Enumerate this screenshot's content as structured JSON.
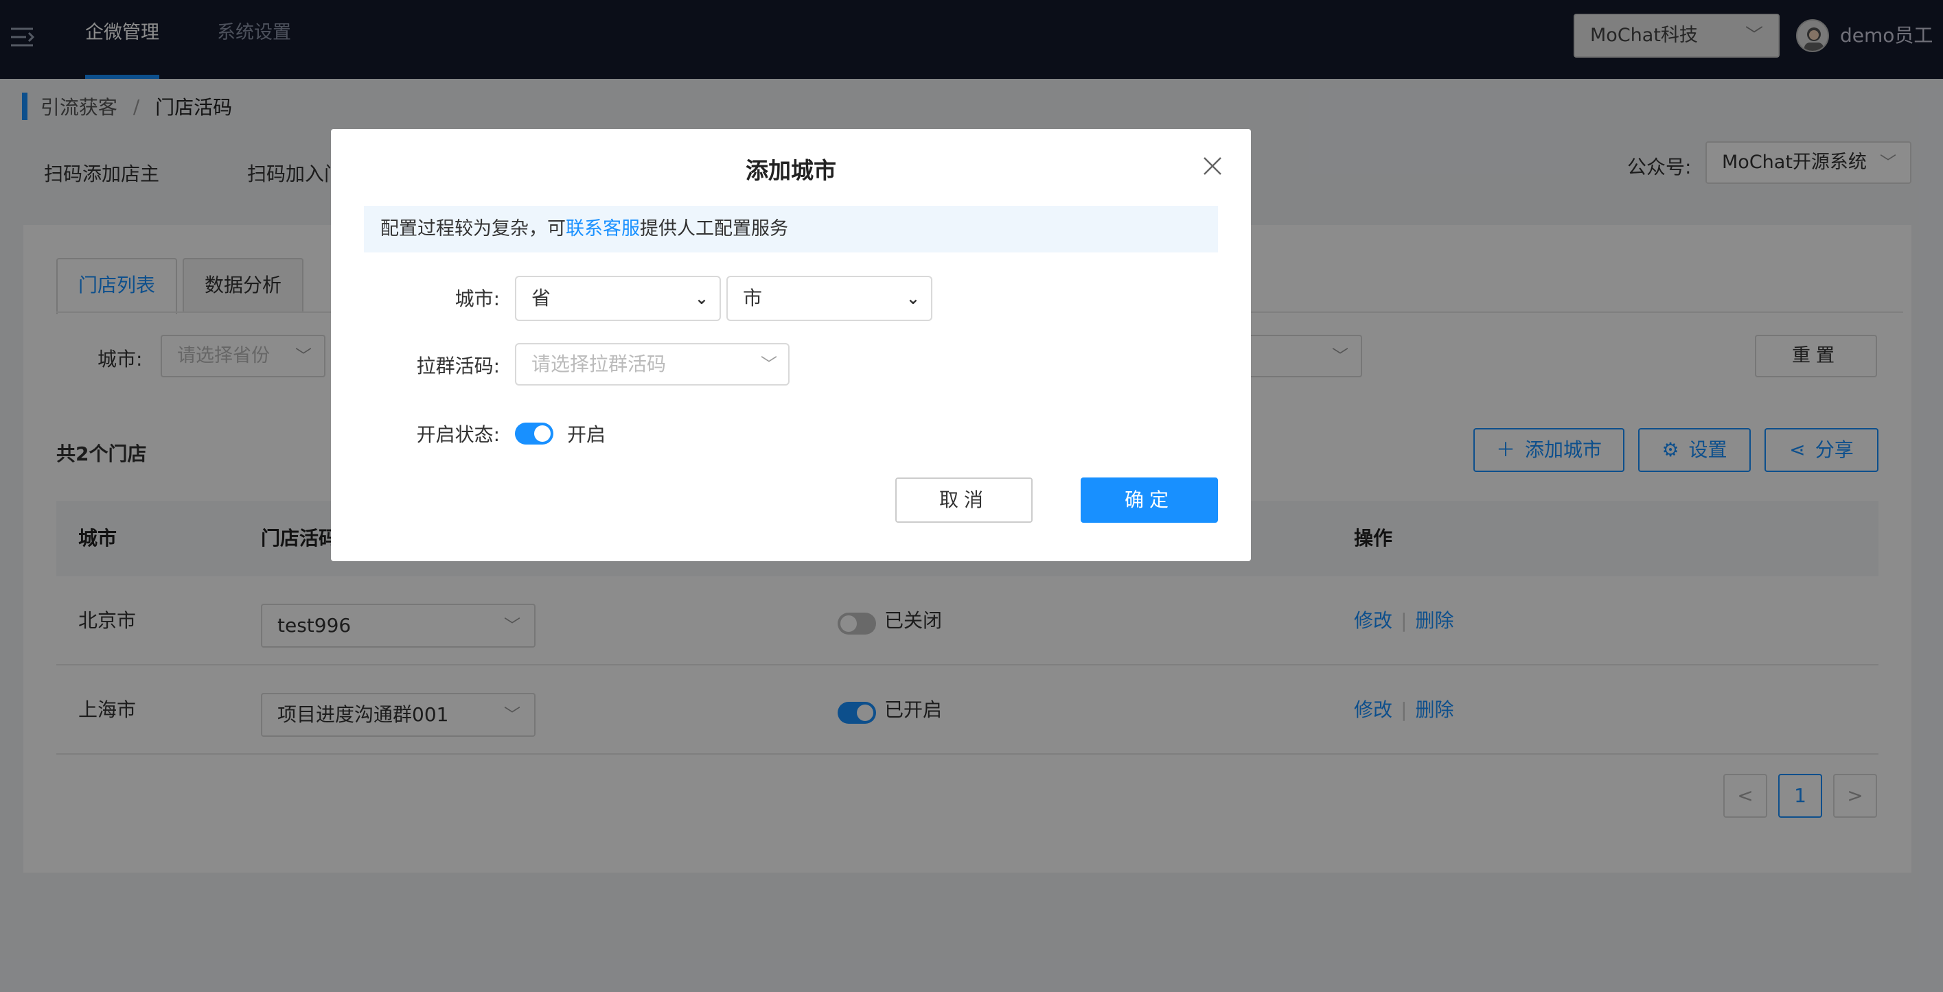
{
  "topbar": {
    "nav": [
      {
        "label": "企微管理",
        "active": true
      },
      {
        "label": "系统设置",
        "active": false
      }
    ],
    "company": "MoChat科技",
    "user_name": "demo员工"
  },
  "breadcrumb": {
    "parent": "引流获客",
    "separator": "/",
    "current": "门店活码"
  },
  "sub_tabs": [
    "扫码添加店主",
    "扫码加入门"
  ],
  "gzh": {
    "label": "公众号:",
    "value": "MoChat开源系统"
  },
  "inner_tabs": [
    {
      "label": "门店列表",
      "active": true
    },
    {
      "label": "数据分析",
      "active": false
    }
  ],
  "filter": {
    "city_label": "城市:",
    "province_placeholder": "请选择省份",
    "reset_label": "重置"
  },
  "summary": {
    "total_label": "共2个门店"
  },
  "toolbar": {
    "add_city_label": "添加城市",
    "settings_label": "设置",
    "share_label": "分享"
  },
  "table": {
    "columns": [
      "城市",
      "门店活码",
      "操作"
    ],
    "rows": [
      {
        "city": "北京市",
        "code": "test996",
        "status": "已关闭",
        "on": false,
        "edit": "修改",
        "delete": "删除"
      },
      {
        "city": "上海市",
        "code": "项目进度沟通群001",
        "status": "已开启",
        "on": true,
        "edit": "修改",
        "delete": "删除"
      }
    ]
  },
  "pagination": {
    "prev": "<",
    "current": "1",
    "next": ">"
  },
  "modal": {
    "title": "添加城市",
    "notice_prefix": "配置过程较为复杂，可",
    "notice_link": "联系客服",
    "notice_suffix": "提供人工配置服务",
    "city_label": "城市:",
    "province_value": "省",
    "city_value": "市",
    "group_code_label": "拉群活码:",
    "group_code_placeholder": "请选择拉群活码",
    "status_label": "开启状态:",
    "status_value": "开启",
    "cancel_label": "取消",
    "ok_label": "确定"
  },
  "colors": {
    "primary": "#1890ff",
    "topbar": "#141b2d"
  }
}
